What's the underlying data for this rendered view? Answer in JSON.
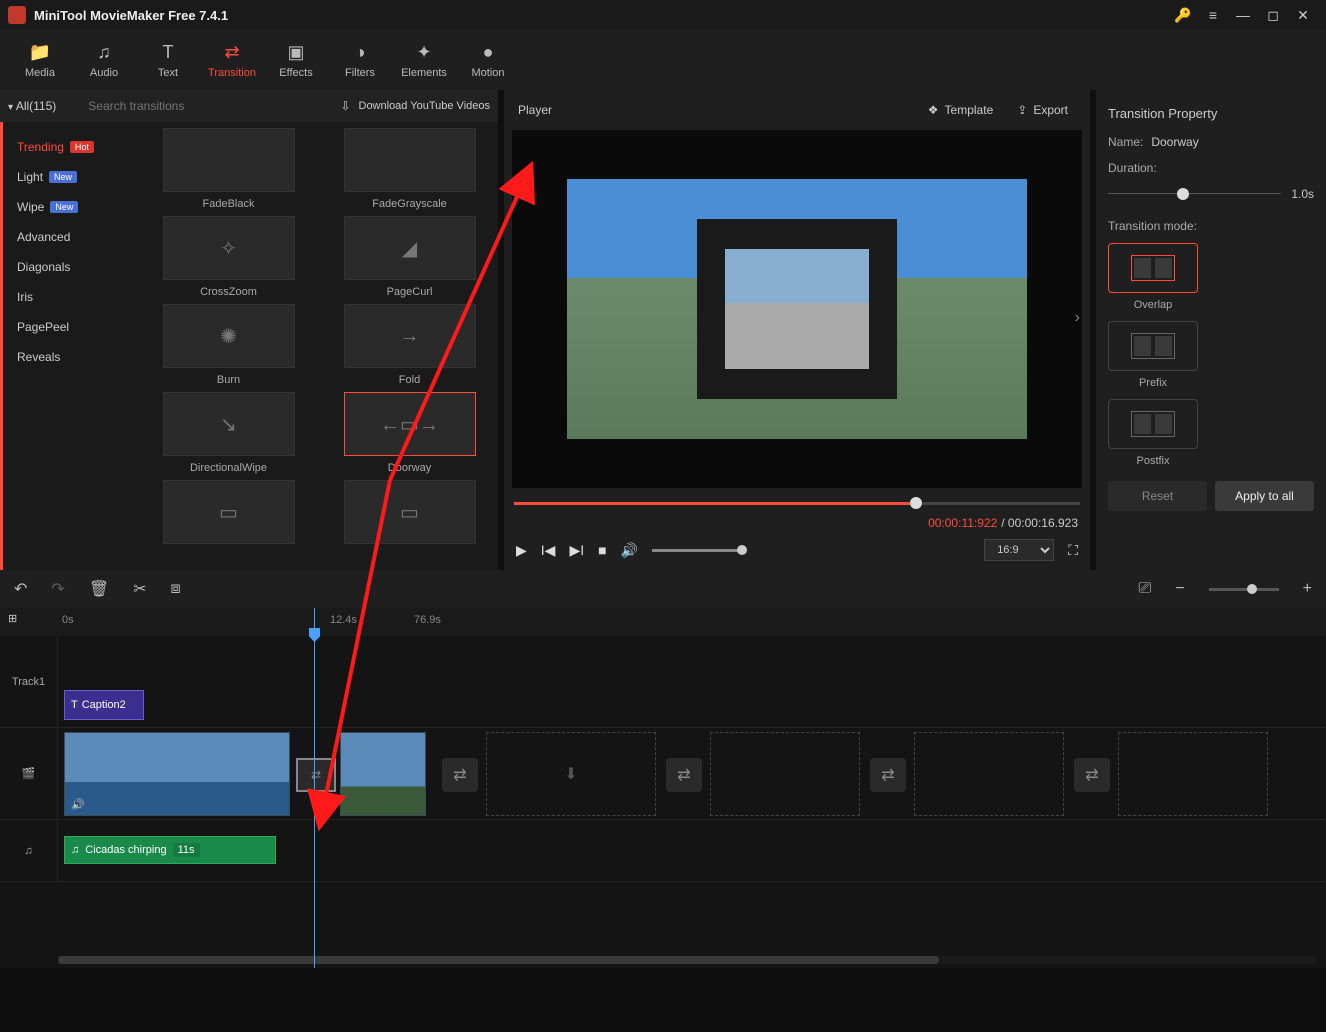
{
  "app": {
    "title": "MiniTool MovieMaker Free 7.4.1"
  },
  "tabs": {
    "media": "Media",
    "audio": "Audio",
    "text": "Text",
    "transition": "Transition",
    "effects": "Effects",
    "filters": "Filters",
    "elements": "Elements",
    "motion": "Motion"
  },
  "catbar": {
    "all": "All(115)",
    "search_placeholder": "Search transitions",
    "download": "Download YouTube Videos"
  },
  "categories": {
    "trending": "Trending",
    "light": "Light",
    "wipe": "Wipe",
    "advanced": "Advanced",
    "diagonals": "Diagonals",
    "iris": "Iris",
    "pagepeel": "PagePeel",
    "reveals": "Reveals",
    "badge_hot": "Hot",
    "badge_new": "New"
  },
  "transitions": {
    "fadeblack": "FadeBlack",
    "fadegray": "FadeGrayscale",
    "crosszoom": "CrossZoom",
    "pagecurl": "PageCurl",
    "burn": "Burn",
    "fold": "Fold",
    "directionalwipe": "DirectionalWipe",
    "doorway": "Doorway"
  },
  "player": {
    "title": "Player",
    "template": "Template",
    "export": "Export",
    "current": "00:00:11:922",
    "total": "/ 00:00:16.923",
    "ratio": "16:9"
  },
  "prop": {
    "title": "Transition Property",
    "name_label": "Name:",
    "name_value": "Doorway",
    "duration_label": "Duration:",
    "duration_value": "1.0s",
    "mode_label": "Transition mode:",
    "overlap": "Overlap",
    "prefix": "Prefix",
    "postfix": "Postfix",
    "reset": "Reset",
    "apply": "Apply to all"
  },
  "ruler": {
    "t0": "0s",
    "t1": "12.4s",
    "t2": "76.9s"
  },
  "timeline": {
    "track1": "Track1",
    "caption": "Caption2",
    "audio_name": "Cicadas chirping",
    "audio_dur": "11s"
  }
}
